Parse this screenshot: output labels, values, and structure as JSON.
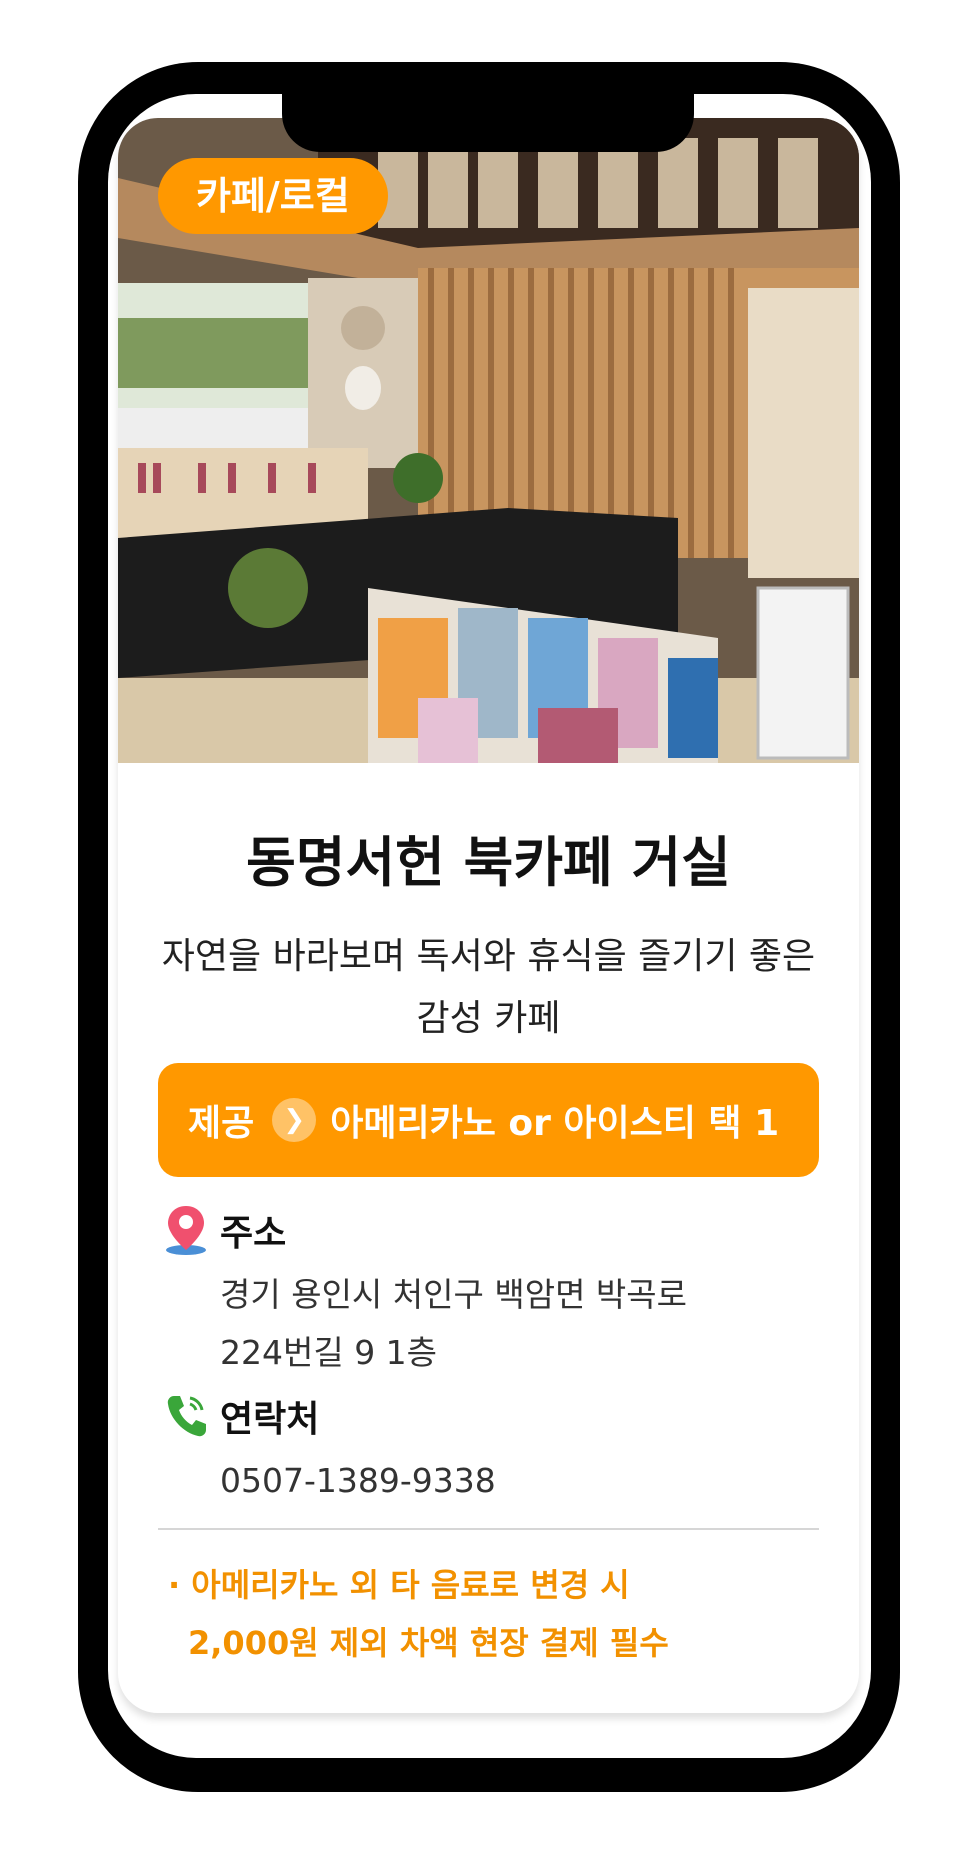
{
  "card": {
    "badge": "카페/로컬",
    "title": "동명서헌 북카페 거실",
    "subtitle": "자연을 바라보며 독서와 휴식을 즐기기 좋은 감성 카페",
    "provide": {
      "label": "제공",
      "value": "아메리카노 or 아이스티 택 1"
    },
    "address": {
      "label": "주소",
      "line1": "경기 용인시 처인구 백암면 박곡로",
      "line2": "224번길 9 1층"
    },
    "contact": {
      "label": "연락처",
      "phone": "0507-1389-9338"
    },
    "note": {
      "line1": "· 아메리카노 외 타 음료로 변경 시",
      "line2": "2,000원 제외 차액 현장 결제 필수"
    }
  },
  "colors": {
    "accent": "#ff9800",
    "note": "#f29100"
  },
  "icons": [
    "location-pin-icon",
    "phone-icon",
    "chevron-right-icon"
  ]
}
